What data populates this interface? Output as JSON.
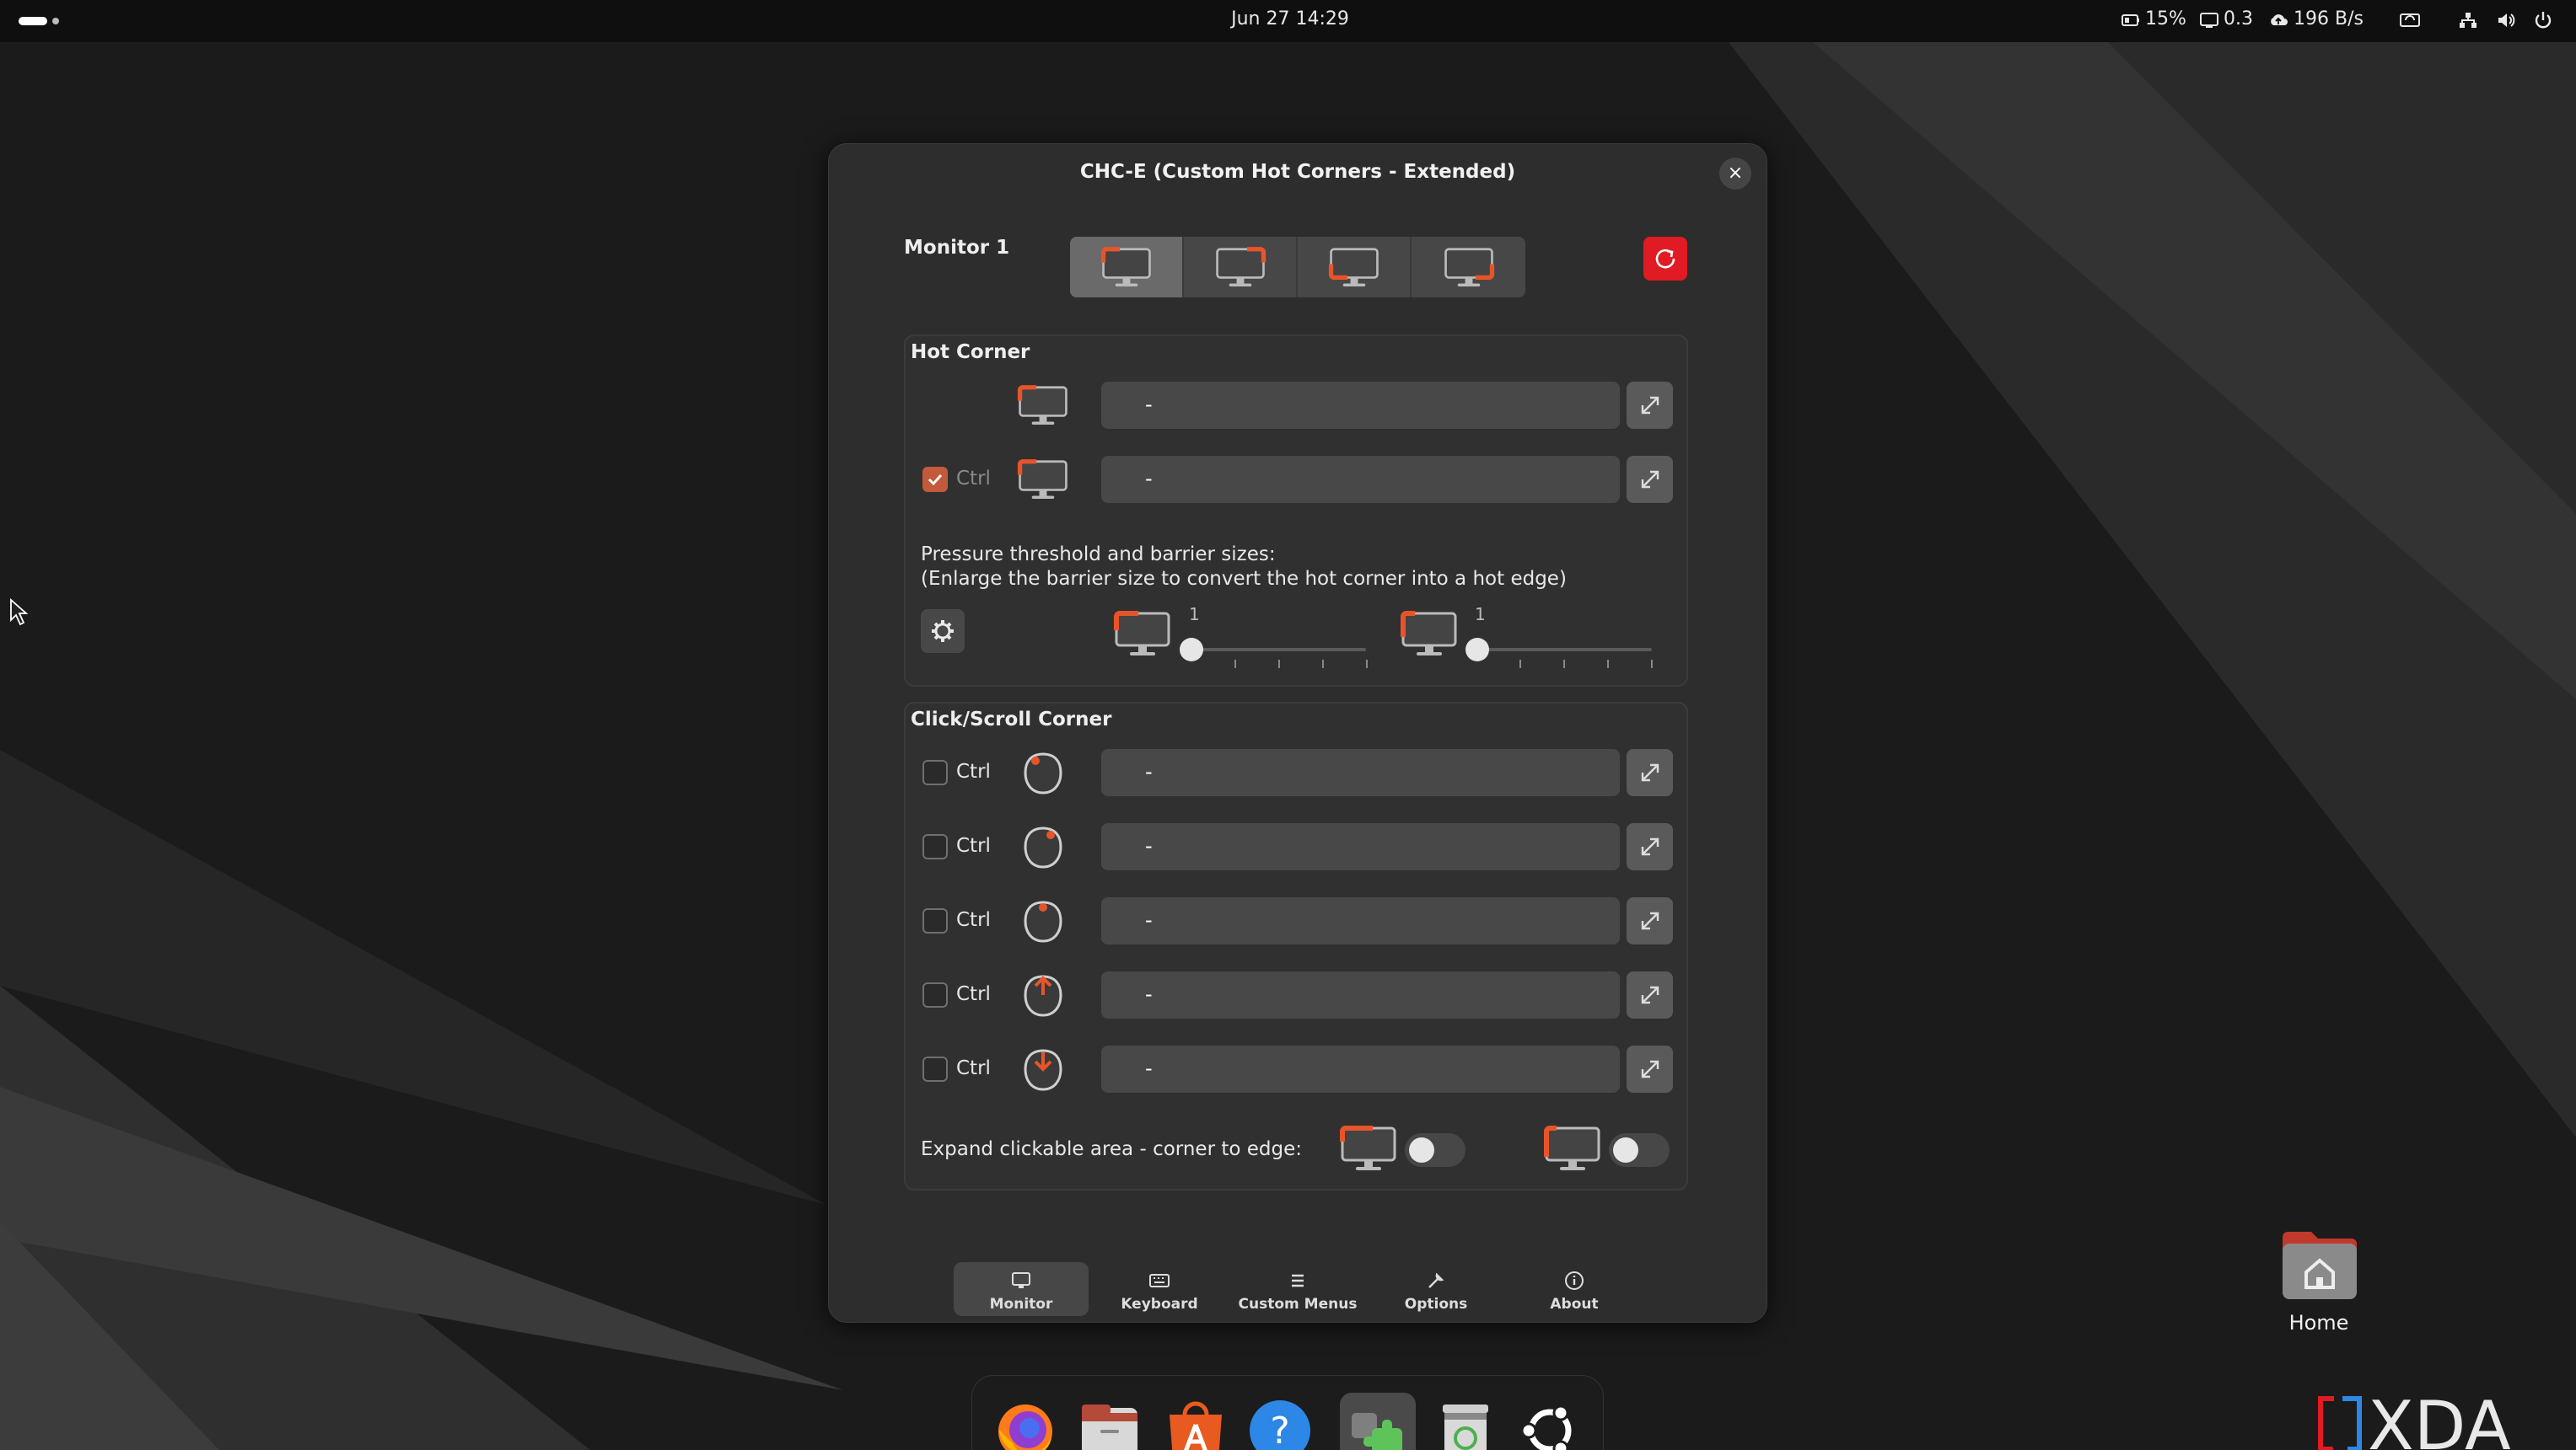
{
  "topbar": {
    "datetime": "Jun 27  14:29",
    "battery": "15%",
    "cpu": "0.3",
    "net_speed": "196 B/s",
    "icons": [
      "activities-indicator-icon",
      "battery-icon",
      "display-icon",
      "upload-cloud-icon",
      "screen-rotate-icon",
      "network-icon",
      "volume-icon",
      "power-icon"
    ]
  },
  "dialog": {
    "title": "CHC-E (Custom Hot Corners - Extended)",
    "close_label": "×",
    "monitor_label": "Monitor 1",
    "corners": [
      "top-left",
      "top-right",
      "bottom-left",
      "bottom-right"
    ],
    "selected_corner": "top-left",
    "accent_color": "#e01b24",
    "hot_corner": {
      "title": "Hot Corner",
      "rows": [
        {
          "ctrl": false,
          "show_ctrl": false,
          "value": "-"
        },
        {
          "ctrl": true,
          "show_ctrl": true,
          "ctrl_label": "Ctrl",
          "value": "-"
        }
      ],
      "pressure_line1": "Pressure threshold and barrier sizes:",
      "pressure_line2": "(Enlarge the barrier size to convert the hot corner into a hot edge)",
      "barrier_h": "1",
      "barrier_v": "1"
    },
    "click_scroll": {
      "title": "Click/Scroll Corner",
      "rows": [
        {
          "ctrl_label": "Ctrl",
          "icon": "mouse-left-click-icon",
          "value": "-"
        },
        {
          "ctrl_label": "Ctrl",
          "icon": "mouse-right-click-icon",
          "value": "-"
        },
        {
          "ctrl_label": "Ctrl",
          "icon": "mouse-middle-click-icon",
          "value": "-"
        },
        {
          "ctrl_label": "Ctrl",
          "icon": "mouse-scroll-up-icon",
          "value": "-"
        },
        {
          "ctrl_label": "Ctrl",
          "icon": "mouse-scroll-down-icon",
          "value": "-"
        }
      ],
      "expand_label": "Expand clickable area - corner to edge:",
      "expand_h_on": false,
      "expand_v_on": false
    },
    "tabs": [
      {
        "label": "Monitor",
        "icon": "monitor-icon",
        "active": true
      },
      {
        "label": "Keyboard",
        "icon": "keyboard-icon",
        "active": false
      },
      {
        "label": "Custom Menus",
        "icon": "menu-list-icon",
        "active": false
      },
      {
        "label": "Options",
        "icon": "wrench-icon",
        "active": false
      },
      {
        "label": "About",
        "icon": "info-icon",
        "active": false
      }
    ]
  },
  "dock": {
    "apps": [
      "firefox",
      "files",
      "app-center",
      "help",
      "extension-manager",
      "trash",
      "ubuntu"
    ],
    "running": "extension-manager"
  },
  "desktop": {
    "home_label": "Home",
    "watermark": "XDA"
  }
}
